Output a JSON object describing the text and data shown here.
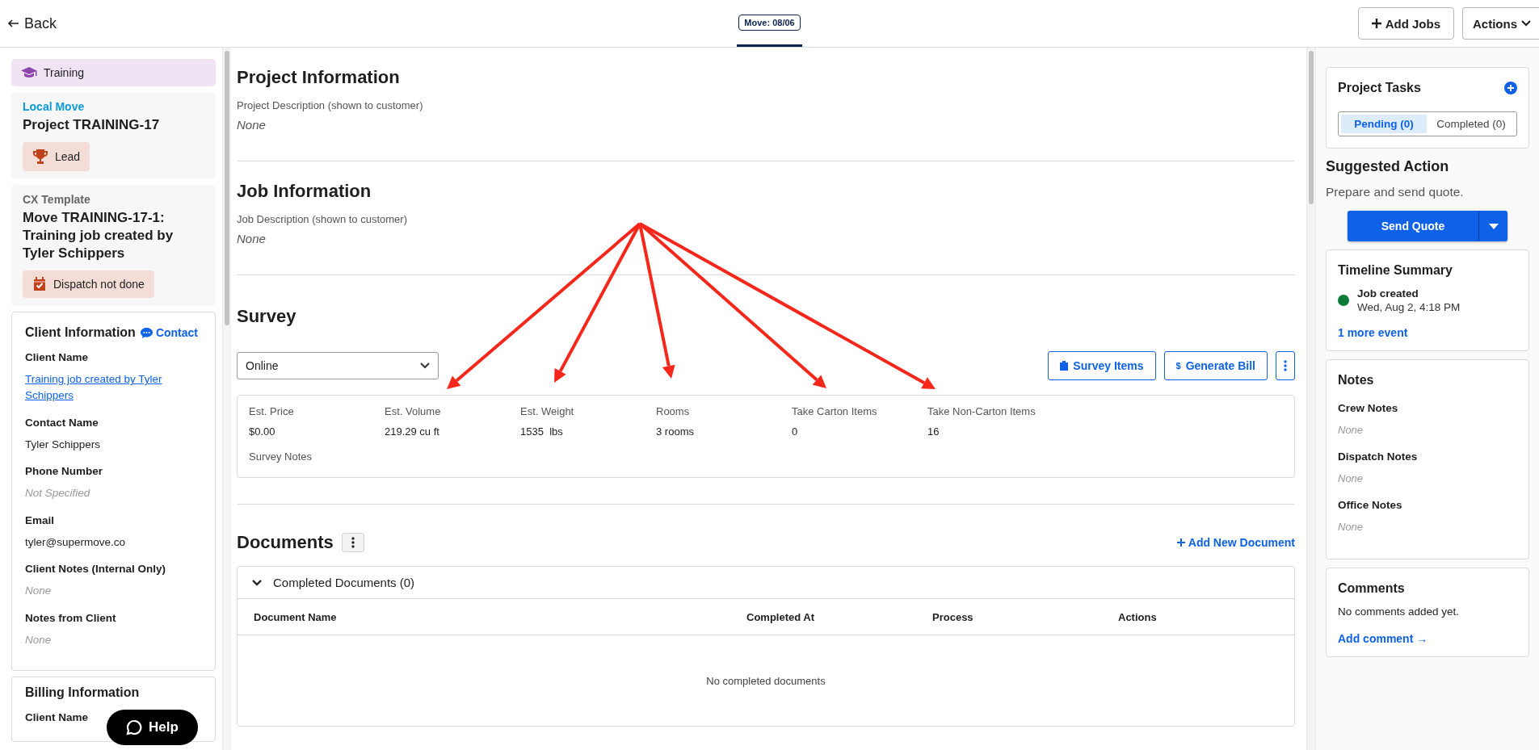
{
  "top_bar": {
    "back": "Back",
    "tabs": [
      {
        "label": "Move: 08/06",
        "selected": true
      }
    ],
    "add_jobs": "Add Jobs",
    "actions": "Actions"
  },
  "sidebar": {
    "training": "Training",
    "project_card": {
      "type": "Local Move",
      "title": "Project TRAINING-17",
      "status": "Lead"
    },
    "job_card": {
      "template": "CX Template",
      "title": "Move TRAINING-17-1: Training job created by Tyler Schippers",
      "status": "Dispatch not done"
    },
    "client_info": {
      "title": "Client Information",
      "contact": "Contact",
      "fields": [
        {
          "label": "Client Name",
          "value": "Training job created by Tyler Schippers",
          "kind": "link"
        },
        {
          "label": "Contact Name",
          "value": "Tyler Schippers",
          "kind": "text"
        },
        {
          "label": "Phone Number",
          "value": "Not Specified",
          "kind": "empty"
        },
        {
          "label": "Email",
          "value": "tyler@supermove.co",
          "kind": "text"
        },
        {
          "label": "Client Notes (Internal Only)",
          "value": "None",
          "kind": "empty"
        },
        {
          "label": "Notes from Client",
          "value": "None",
          "kind": "empty"
        }
      ]
    },
    "billing_info": {
      "title": "Billing Information",
      "first_label": "Client Name"
    }
  },
  "main": {
    "project_info": {
      "title": "Project Information",
      "label": "Project Description (shown to customer)",
      "value": "None"
    },
    "job_info": {
      "title": "Job Information",
      "label": "Job Description (shown to customer)",
      "value": "None"
    },
    "survey": {
      "title": "Survey",
      "method": "Online",
      "survey_items": "Survey Items",
      "generate_bill_icon": "$",
      "generate_bill": "Generate Bill",
      "stats": [
        {
          "label": "Est. Price",
          "value": "$0.00"
        },
        {
          "label": "Est. Volume",
          "value": "219.29 cu ft"
        },
        {
          "label": "Est. Weight",
          "value": "1535  lbs"
        },
        {
          "label": "Rooms",
          "value": "3 rooms"
        },
        {
          "label": "Take Carton Items",
          "value": "0"
        },
        {
          "label": "Take Non-Carton Items",
          "value": "16"
        }
      ],
      "notes_label": "Survey Notes"
    },
    "documents": {
      "title": "Documents",
      "add": "Add New Document",
      "section": {
        "title": "Completed Documents (0)",
        "expanded": true,
        "columns": [
          "Document Name",
          "Completed At",
          "Process",
          "Actions"
        ],
        "empty": "No completed documents"
      }
    }
  },
  "right_panel": {
    "project_tasks": {
      "title": "Project Tasks",
      "tabs": [
        {
          "label": "Pending (0)",
          "selected": true
        },
        {
          "label": "Completed (0)",
          "selected": false
        }
      ]
    },
    "suggested_action": {
      "title": "Suggested Action",
      "text": "Prepare and send quote.",
      "button": "Send Quote"
    },
    "timeline": {
      "title": "Timeline Summary",
      "events": [
        {
          "title": "Job created",
          "time": "Wed, Aug 2, 4:18 PM",
          "color": "#0e7a37"
        }
      ],
      "more": "1 more event"
    },
    "notes": {
      "title": "Notes",
      "items": [
        {
          "label": "Crew Notes",
          "value": "None"
        },
        {
          "label": "Dispatch Notes",
          "value": "None"
        },
        {
          "label": "Office Notes",
          "value": "None"
        }
      ]
    },
    "comments": {
      "title": "Comments",
      "text": "No comments added yet.",
      "add": "Add comment →"
    }
  },
  "help": "Help"
}
